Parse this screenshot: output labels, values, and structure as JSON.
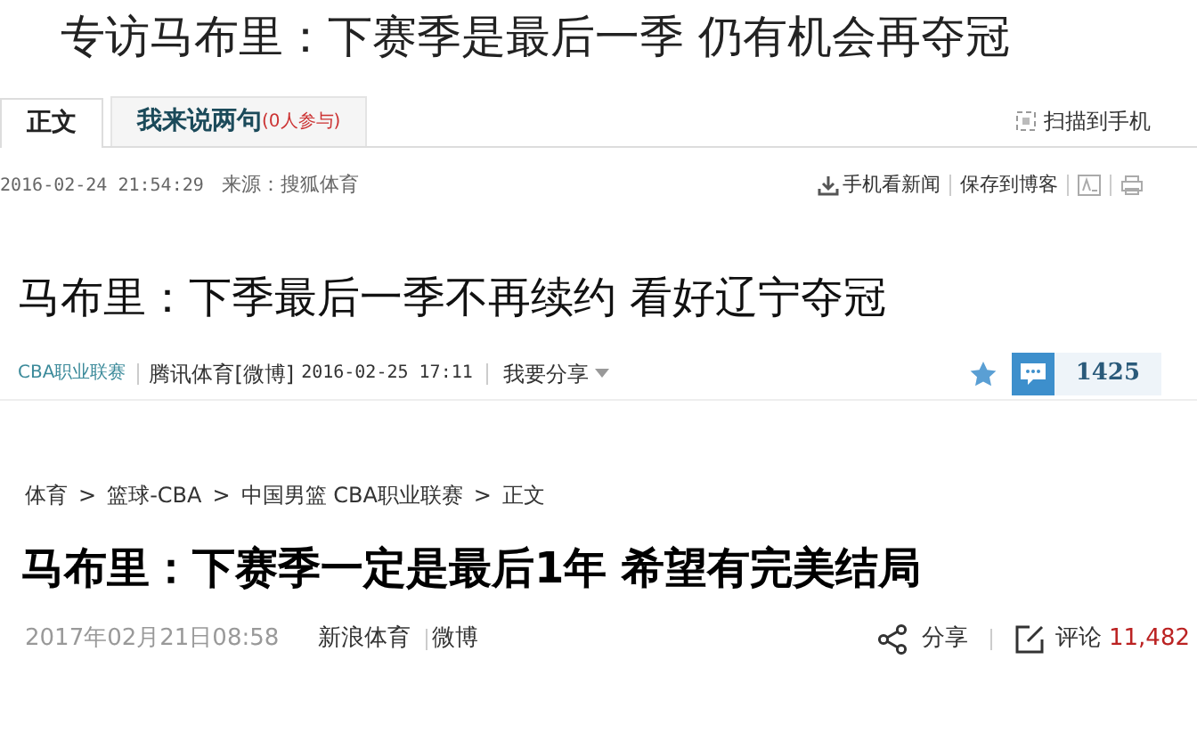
{
  "page_title": "专访马布里：下赛季是最后一季  仍有机会再夺冠",
  "sohu": {
    "tabs": [
      {
        "label": "正文",
        "selected": true
      },
      {
        "label": "我来说两句",
        "count": "(0人参与)",
        "selected": false
      }
    ],
    "scan_link": "扫描到手机",
    "datetime": "2016-02-24 21:54:29",
    "source": "来源：搜狐体育",
    "actions": [
      "手机看新闻",
      "保存到博客"
    ]
  },
  "qq": {
    "headline": "马布里：下季最后一季不再续约 看好辽宁夺冠",
    "category": "CBA职业联赛",
    "source": "腾讯体育[微博]",
    "datetime": "2016-02-25 17:11",
    "share": "我要分享",
    "comment_count": "1425"
  },
  "sina": {
    "breadcrumb": [
      "体育",
      "篮球-CBA",
      "中国男篮 CBA职业联赛",
      "正文"
    ],
    "separator": ">",
    "headline": "马布里：下赛季一定是最后1年 希望有完美结局",
    "datetime": "2017年02月21日08:58",
    "source": "新浪体育",
    "weibo": "微博",
    "share": "分享",
    "comment": "评论",
    "comment_count": "11,482"
  }
}
